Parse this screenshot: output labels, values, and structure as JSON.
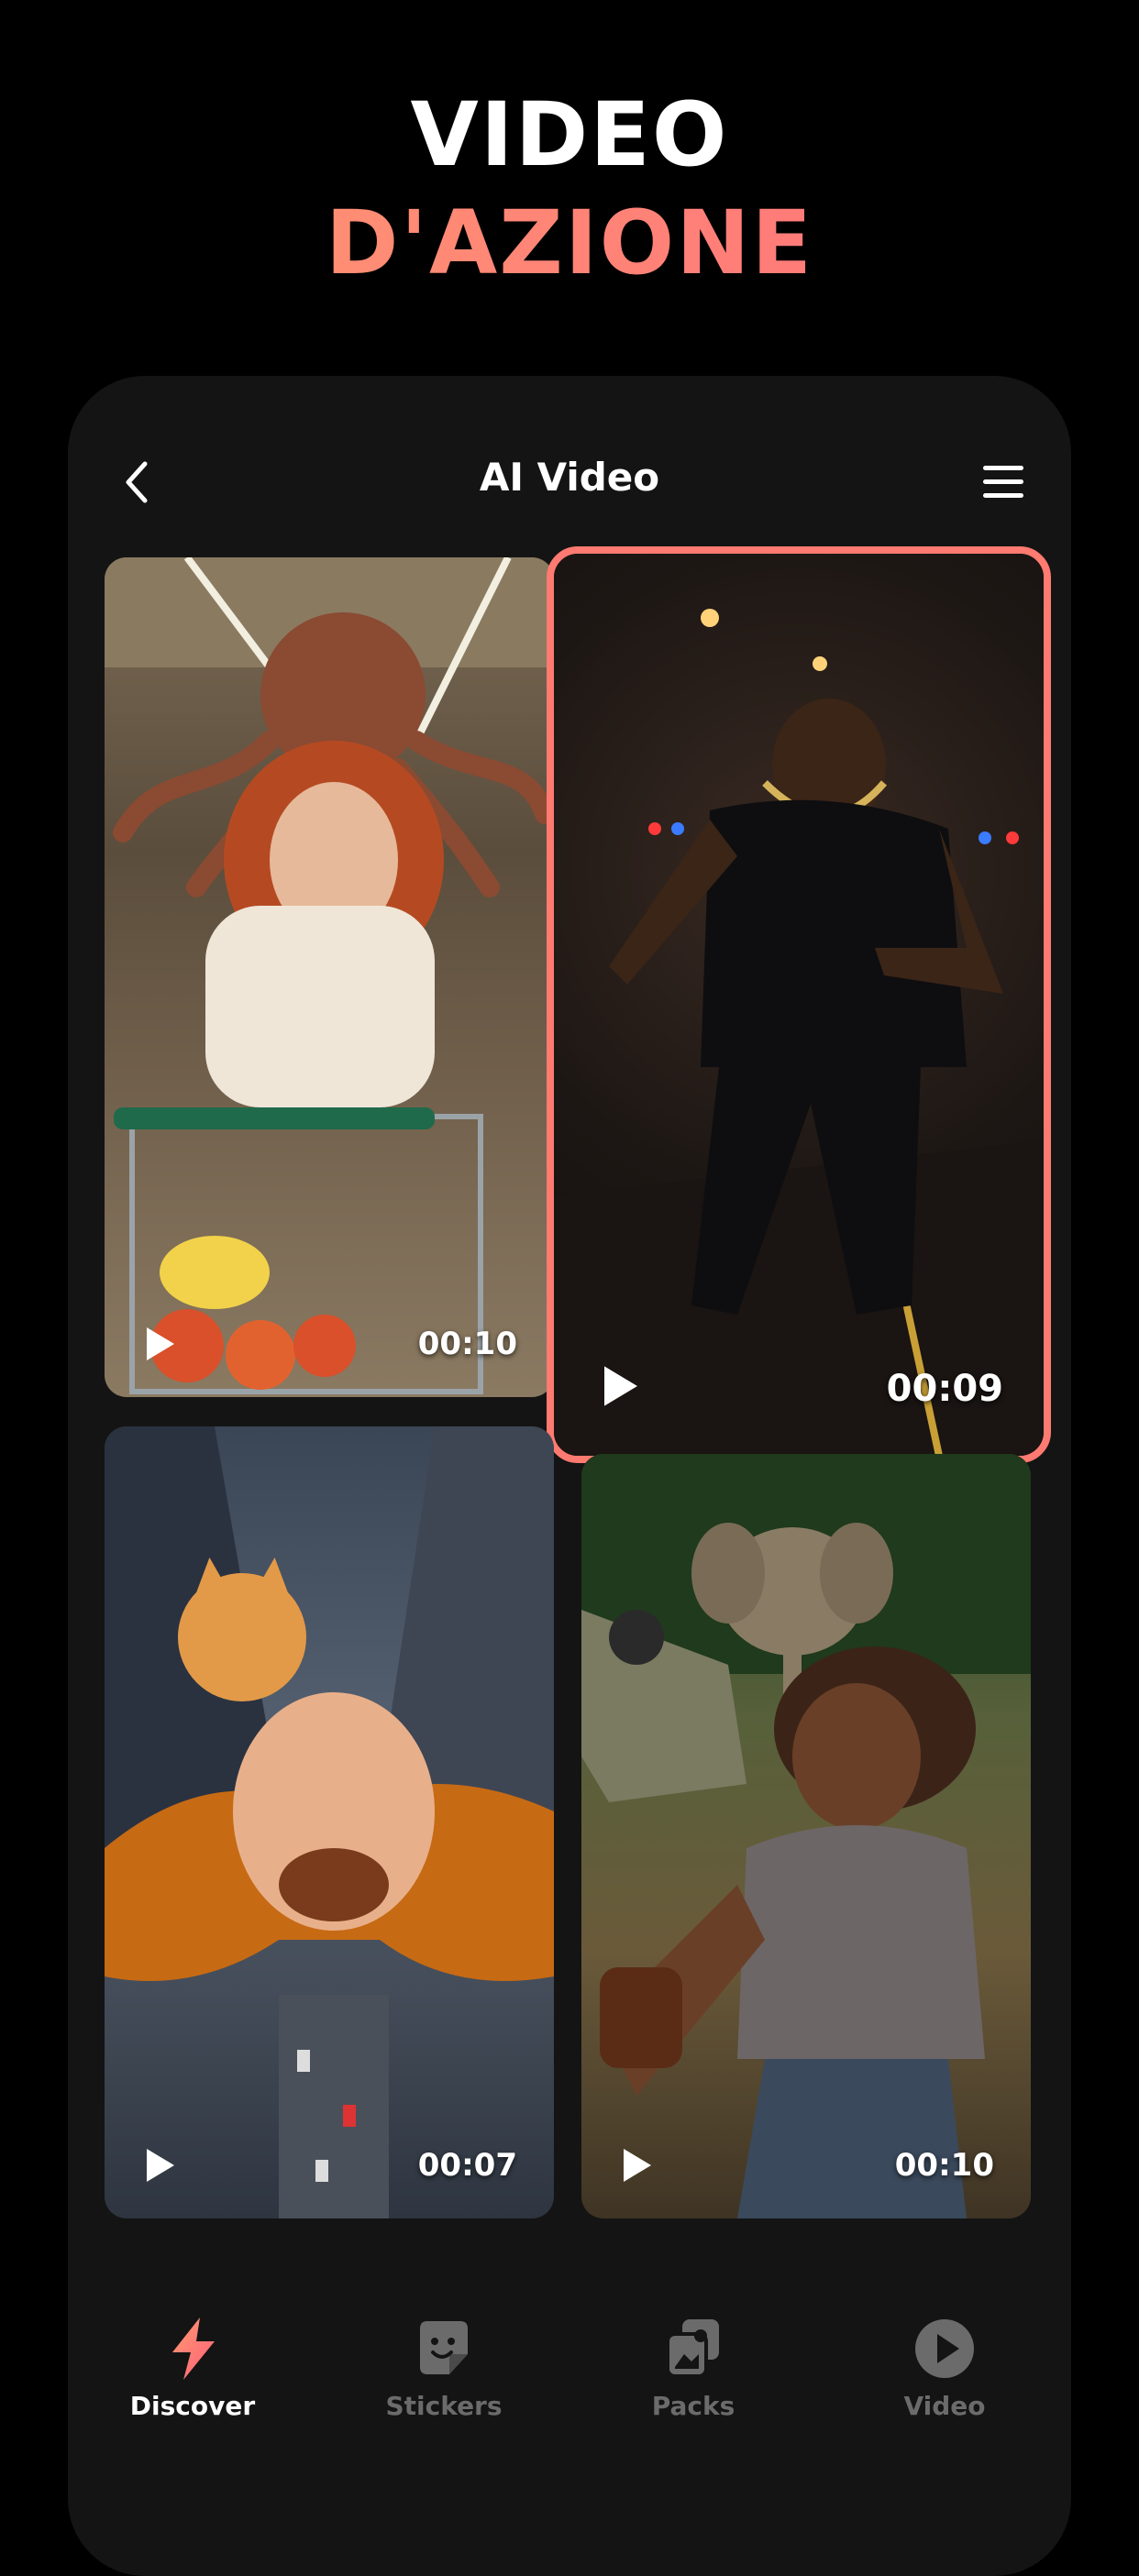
{
  "headline": {
    "line1": "VIDEO",
    "line2": "D'AZIONE"
  },
  "header": {
    "title": "AI Video",
    "back_icon": "chevron-left-icon",
    "menu_icon": "hamburger-menu-icon"
  },
  "videos": [
    {
      "duration": "00:10",
      "selected": false
    },
    {
      "duration": "00:09",
      "selected": true
    },
    {
      "duration": "00:07",
      "selected": false
    },
    {
      "duration": "00:10",
      "selected": false
    }
  ],
  "tabs": [
    {
      "label": "Discover",
      "icon": "lightning-icon",
      "active": true
    },
    {
      "label": "Stickers",
      "icon": "sticker-icon",
      "active": false
    },
    {
      "label": "Packs",
      "icon": "packs-icon",
      "active": false
    },
    {
      "label": "Video",
      "icon": "play-circle-icon",
      "active": false
    }
  ],
  "colors": {
    "accent": "#ff7a70",
    "background": "#000000",
    "panel": "#141414"
  }
}
